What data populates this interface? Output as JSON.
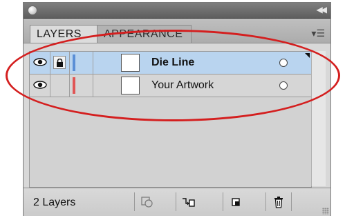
{
  "tabs": [
    {
      "label": "LAYERS"
    },
    {
      "label": "APPEARANCE"
    }
  ],
  "layers": [
    {
      "name": "Die Line",
      "color": "#5b8fd6",
      "visible": true,
      "locked": true,
      "selected": true
    },
    {
      "name": "Your Artwork",
      "color": "#e05555",
      "visible": true,
      "locked": false,
      "selected": false
    }
  ],
  "status": {
    "layer_count": "2 Layers"
  },
  "icons": {
    "close": "close-circle-icon",
    "collapse": "double-chevron-icon",
    "panel_menu": "panel-menu-icon",
    "eye": "eye-icon",
    "lock": "lock-icon",
    "target": "target-circle-icon",
    "make_clipping_mask": "clipping-mask-icon",
    "create_sublayer": "create-sublayer-icon",
    "create_layer": "new-layer-icon",
    "delete": "trash-icon"
  },
  "colors": {
    "selection_bg": "#b9d4ef",
    "annotation": "#d41f1f"
  }
}
